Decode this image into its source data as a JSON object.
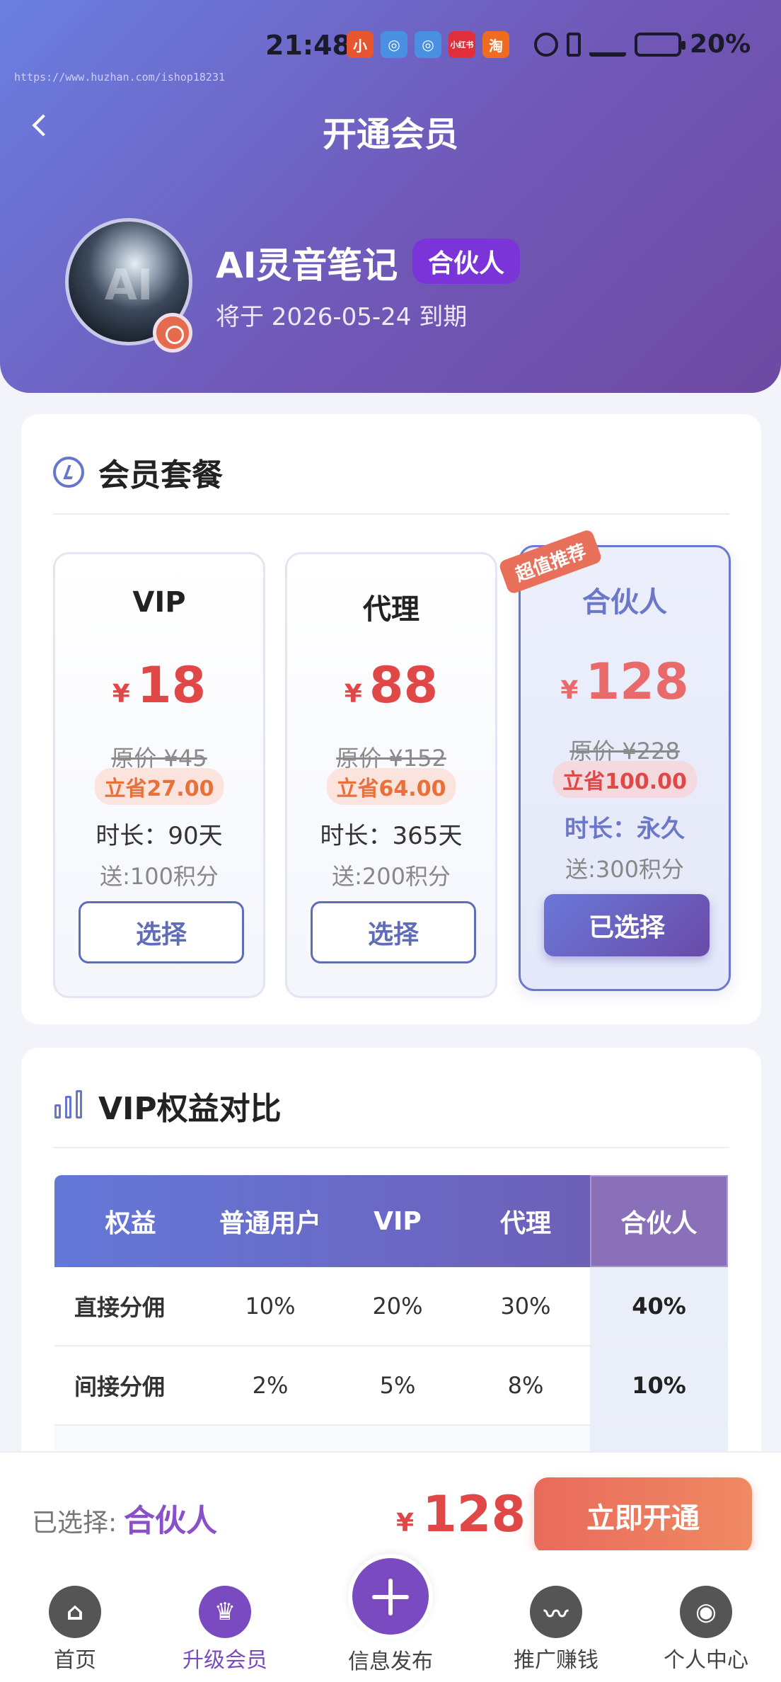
{
  "status": {
    "time": "21:48",
    "battery": "20%",
    "apps": [
      "小",
      "◎",
      "◎",
      "小红书",
      "淘"
    ]
  },
  "watermark": "https://www.huzhan.com/ishop18231",
  "header": {
    "title": "开通会员",
    "user_name": "AI灵音笔记",
    "role": "合伙人",
    "expire": "将于 2026-05-24 到期"
  },
  "plans_section": {
    "title": "会员套餐"
  },
  "plans": [
    {
      "name": "VIP",
      "currency": "¥",
      "price": "18",
      "original": "原价 ¥45",
      "save": "立省27.00",
      "duration": "时长：90天",
      "points": "送:100积分",
      "button": "选择"
    },
    {
      "name": "代理",
      "currency": "¥",
      "price": "88",
      "original": "原价 ¥152",
      "save": "立省64.00",
      "duration": "时长：365天",
      "points": "送:200积分",
      "button": "选择"
    },
    {
      "name": "合伙人",
      "currency": "¥",
      "price": "128",
      "original": "原价 ¥228",
      "save": "立省100.00",
      "duration": "时长：永久",
      "points": "送:300积分",
      "button": "已选择",
      "ribbon": "超值推荐"
    }
  ],
  "compare": {
    "title": "VIP权益对比",
    "headers": [
      "权益",
      "普通用户",
      "VIP",
      "代理",
      "合伙人"
    ],
    "rows": [
      [
        "直接分佣",
        "10%",
        "20%",
        "30%",
        "40%"
      ],
      [
        "间接分佣",
        "2%",
        "5%",
        "8%",
        "10%"
      ]
    ]
  },
  "buybar": {
    "selected_label": "已选择:",
    "selected_value": "合伙人",
    "currency": "¥",
    "total": "128",
    "button": "立即开通"
  },
  "tabs": {
    "home": "首页",
    "upgrade": "升级会员",
    "publish": "信息发布",
    "promote": "推广赚钱",
    "profile": "个人中心"
  },
  "colors": {
    "primary": "#6a78d8",
    "accent": "#7a4ac0",
    "price": "#e04848",
    "cta": "#e96a5c"
  }
}
